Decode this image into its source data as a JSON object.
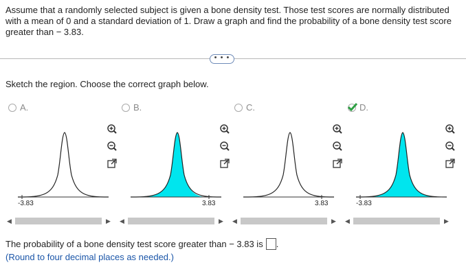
{
  "question": {
    "text": "Assume that a randomly selected subject is given a bone density test. Those test scores are normally distributed with a mean of 0 and a standard deviation of 1. Draw a graph and find the probability of a bone density test score greater than  − 3.83."
  },
  "more_button": {
    "label": "• • •"
  },
  "prompt": "Sketch the region. Choose the correct graph below.",
  "options": [
    {
      "letter": "A.",
      "tick_label": "-3.83",
      "shaded": false,
      "selected": false
    },
    {
      "letter": "B.",
      "tick_label": "3.83",
      "shaded": true,
      "selected": false
    },
    {
      "letter": "C.",
      "tick_label": "3.83",
      "shaded": false,
      "selected": false
    },
    {
      "letter": "D.",
      "tick_label": "-3.83",
      "shaded": true,
      "selected": true
    }
  ],
  "icons": {
    "zoom_in": "zoom-in-icon",
    "zoom_out": "zoom-out-icon",
    "expand": "expand-icon",
    "radio": "radio-icon",
    "check": "check-icon"
  },
  "colors": {
    "shade": "#00e5ee",
    "check": "#2ea043",
    "hint": "#1a55a8"
  },
  "answer": {
    "prefix": "The probability of a bone density test score greater than  − 3.83 is",
    "suffix": ".",
    "value": ""
  },
  "hint": "(Round to four decimal places as needed.)"
}
